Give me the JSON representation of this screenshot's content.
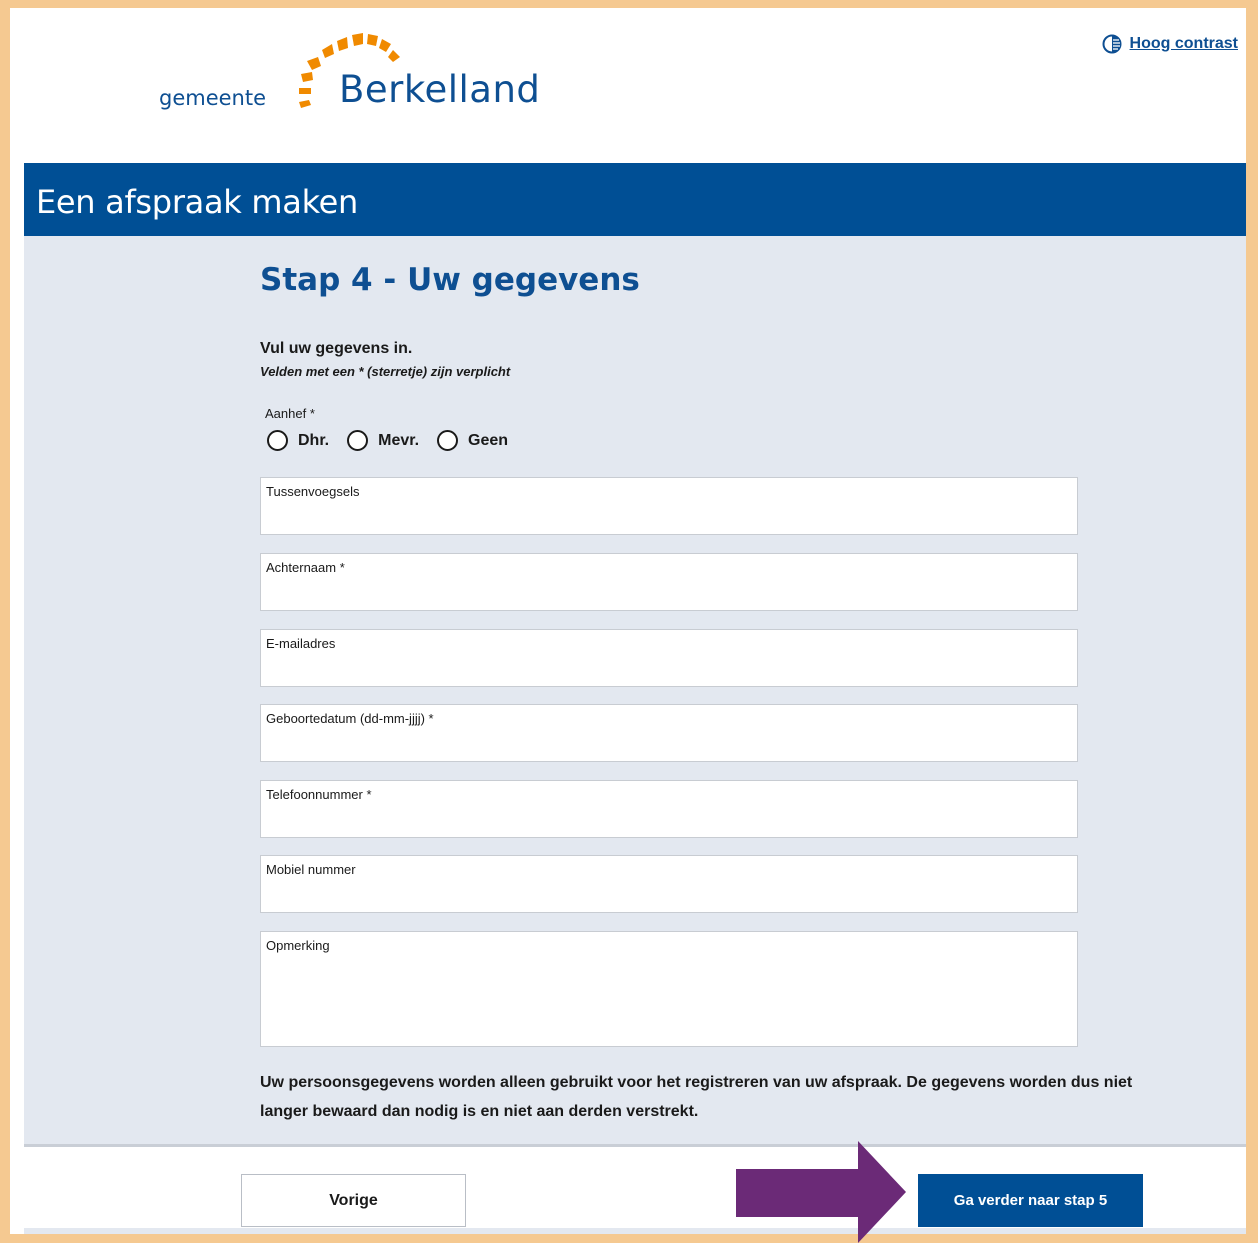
{
  "header": {
    "logo_prefix": "gemeente",
    "logo_name": "Berkelland",
    "contrast_link": "Hoog contrast"
  },
  "banner": {
    "title": "Een afspraak maken"
  },
  "form": {
    "step_title": "Stap 4 - Uw gegevens",
    "intro": "Vul uw gegevens in.",
    "required_note": "Velden met een * (sterretje) zijn verplicht",
    "salutation": {
      "label": "Aanhef *",
      "options": [
        "Dhr.",
        "Mevr.",
        "Geen"
      ]
    },
    "fields": [
      {
        "label": "Tussenvoegsels",
        "value": ""
      },
      {
        "label": "Achternaam *",
        "value": ""
      },
      {
        "label": "E-mailadres",
        "value": ""
      },
      {
        "label": "Geboortedatum (dd-mm-jjjj) *",
        "value": ""
      },
      {
        "label": "Telefoonnummer *",
        "value": ""
      },
      {
        "label": "Mobiel nummer",
        "value": ""
      },
      {
        "label": "Opmerking",
        "value": ""
      }
    ],
    "privacy_text": "Uw persoonsgegevens worden alleen gebruikt voor het registreren van uw afspraak. De gegevens worden dus niet langer bewaard dan nodig is en niet aan derden verstrekt."
  },
  "footer": {
    "prev_label": "Vorige",
    "next_label": "Ga verder naar stap 5"
  },
  "colors": {
    "brand_blue": "#004f95",
    "logo_orange": "#f08a00",
    "annotation_arrow": "#6b2a77",
    "outer_border": "#f5c991"
  }
}
